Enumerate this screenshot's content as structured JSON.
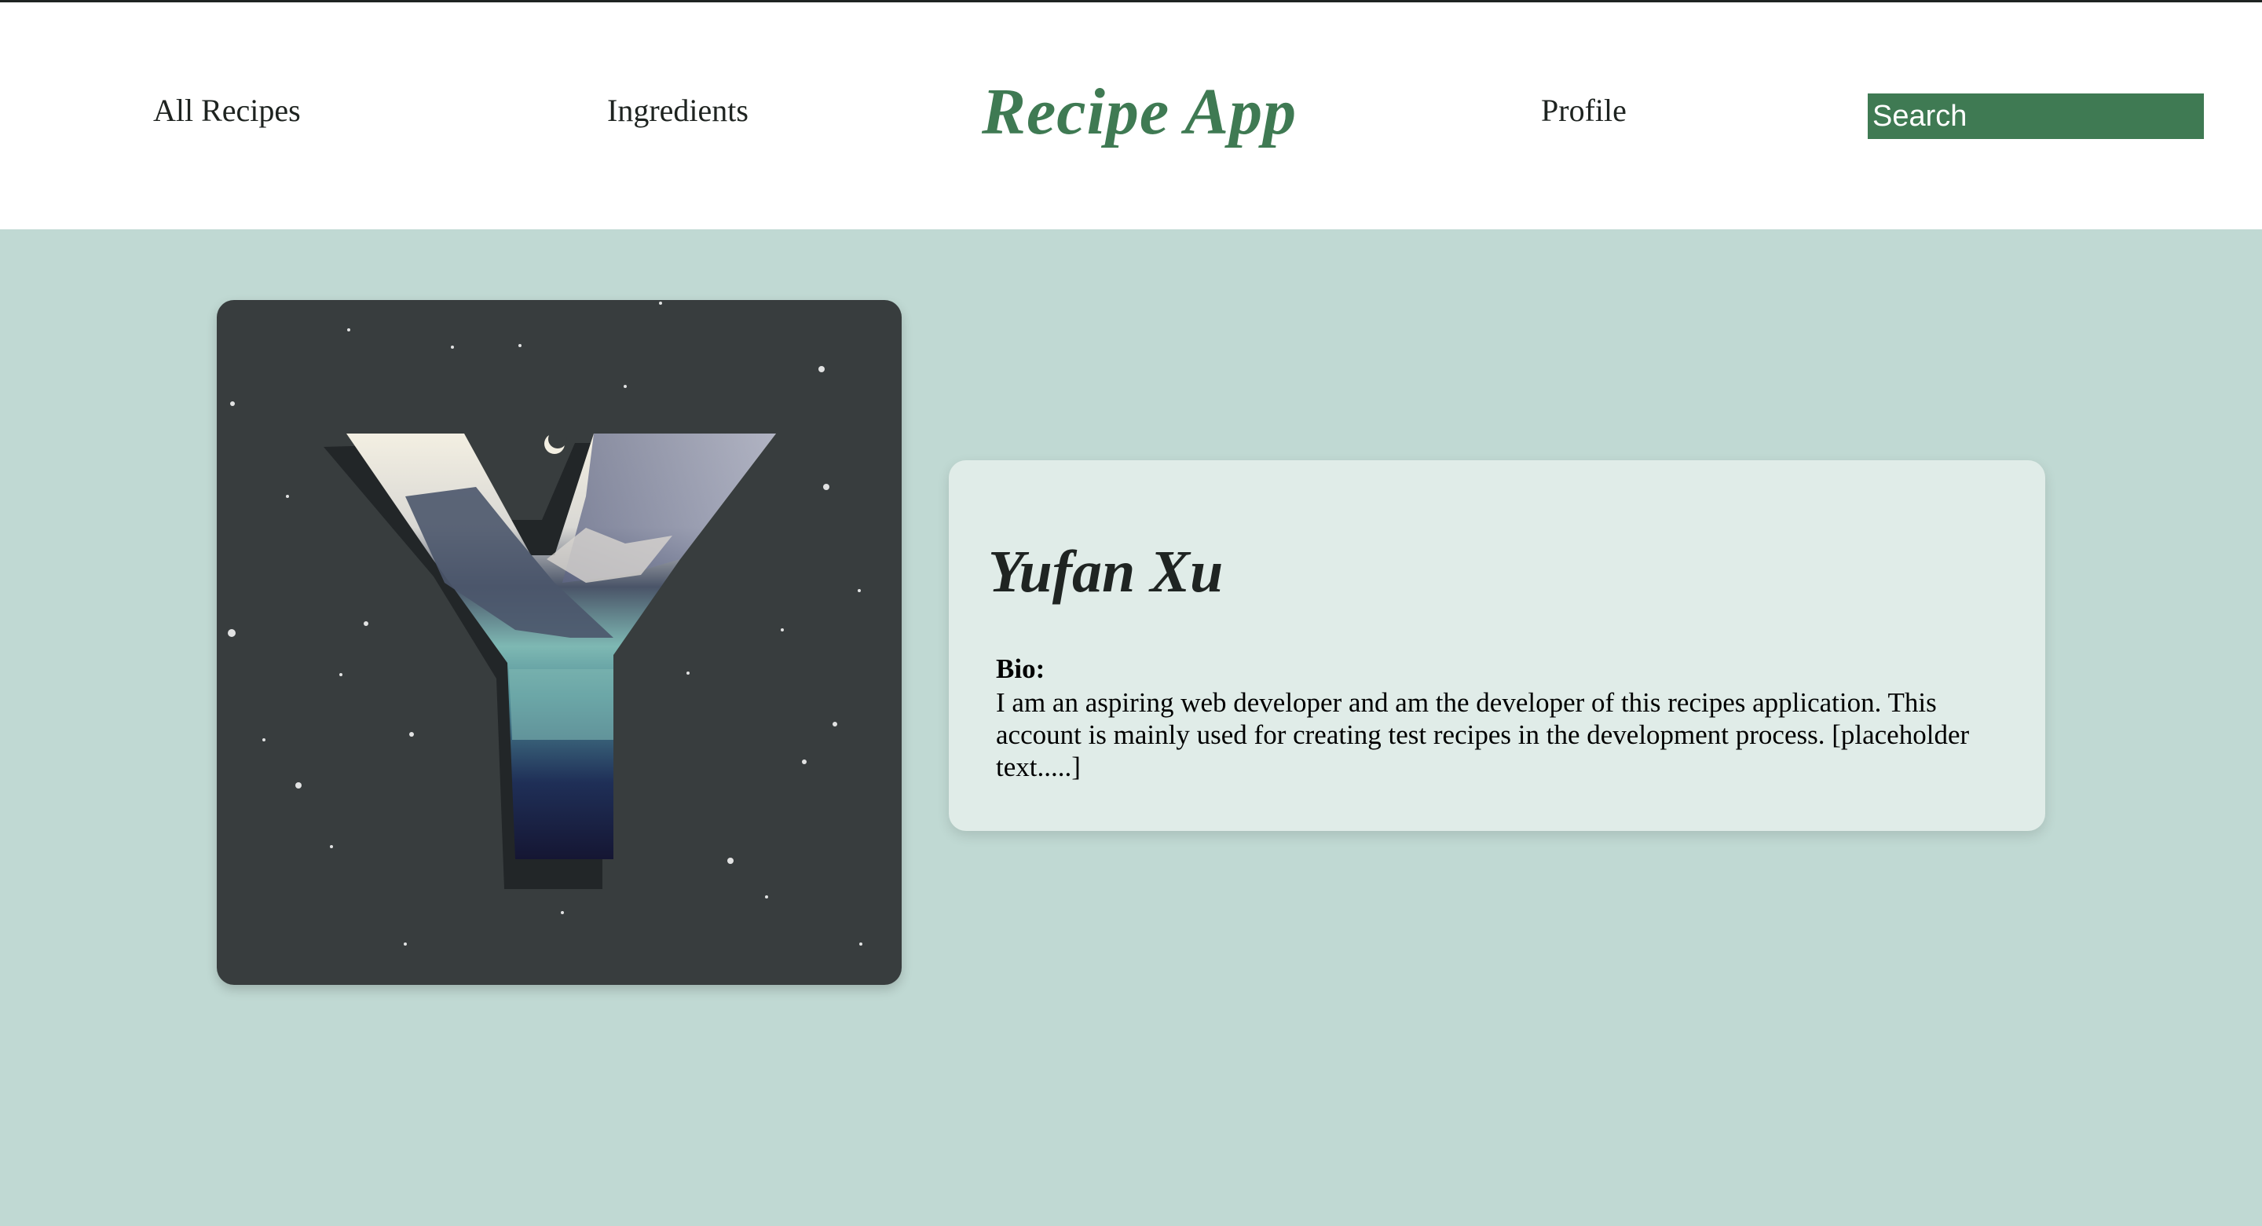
{
  "window": {
    "title": "Recipe App"
  },
  "nav": {
    "all_recipes": "All Recipes",
    "ingredients": "Ingredients",
    "brand": "Recipe App",
    "profile": "Profile",
    "search_placeholder": "Search"
  },
  "profile": {
    "avatar_icon": "letter-y-landscape-avatar",
    "name": "Yufan Xu",
    "bio_label": "Bio:",
    "bio_text": "I am an aspiring web developer and am the developer of this recipes application. This account is mainly used for creating test recipes in the development process. [placeholder text.....]"
  },
  "colors": {
    "page_background": "#c0d9d3",
    "nav_background": "#ffffff",
    "brand_green": "#3f7a53",
    "card_background": "#e0ece8",
    "avatar_background": "#383d3e",
    "text_dark": "#1f2422"
  }
}
